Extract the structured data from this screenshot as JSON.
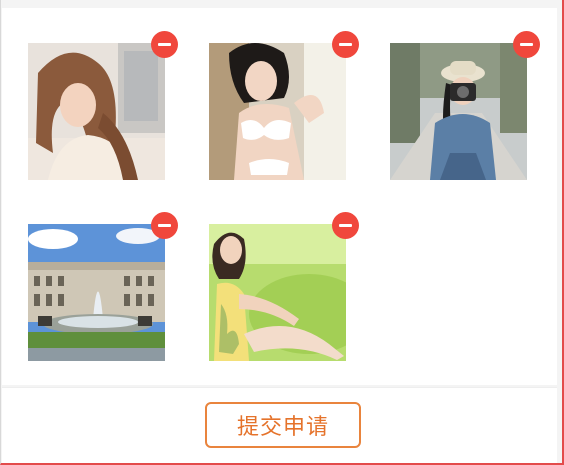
{
  "photos": [
    {
      "name": "photo-1",
      "remove_icon": "minus-circle-icon"
    },
    {
      "name": "photo-2",
      "remove_icon": "minus-circle-icon"
    },
    {
      "name": "photo-3",
      "remove_icon": "minus-circle-icon"
    },
    {
      "name": "photo-4",
      "remove_icon": "minus-circle-icon"
    },
    {
      "name": "photo-5",
      "remove_icon": "minus-circle-icon"
    }
  ],
  "footer": {
    "submit_label": "提交申请"
  },
  "colors": {
    "remove_badge": "#f0473c",
    "accent": "#e5732b",
    "frame_border": "#e34b4b"
  }
}
